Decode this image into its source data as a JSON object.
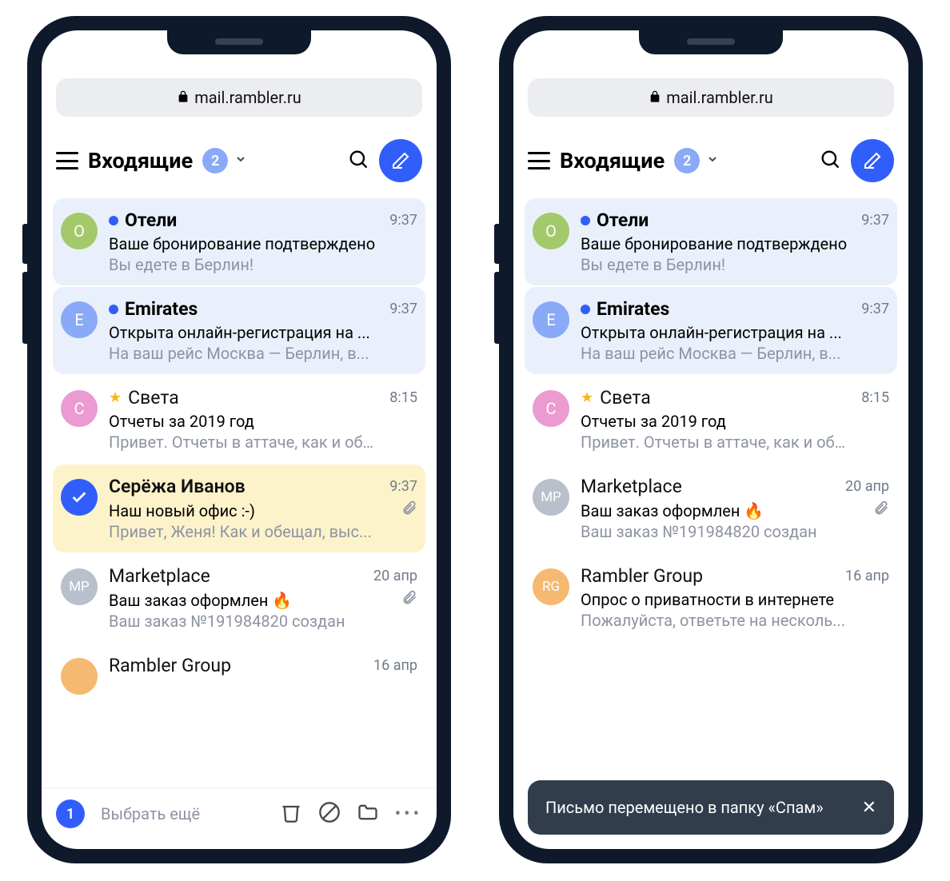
{
  "url": "mail.rambler.ru",
  "header": {
    "folder": "Входящие",
    "unread_count": "2"
  },
  "left": {
    "emails": [
      {
        "avatar_letter": "О",
        "avatar_color": "#a3c96b",
        "unread": true,
        "sender": "Отели",
        "time": "9:37",
        "subject": "Ваше бронирование подтверждено",
        "preview": "Вы едете в Берлин!"
      },
      {
        "avatar_letter": "E",
        "avatar_color": "#8aaaf8",
        "unread": true,
        "sender": "Emirates",
        "time": "9:37",
        "subject": "Открыта онлайн-регистрация на ...",
        "preview": "На ваш рейс Москва — Берлин, в..."
      },
      {
        "avatar_letter": "С",
        "avatar_color": "#eb9bd1",
        "starred": true,
        "sender": "Света",
        "time": "8:15",
        "subject": "Отчеты за 2019 год",
        "preview": "Привет. Отчеты в аттаче, как и об…"
      },
      {
        "selected": true,
        "sender": "Серёжа Иванов",
        "time": "9:37",
        "subject": "Наш новый офис :-)",
        "preview": "Привет, Женя! Как и обещал, выс...",
        "attachment": true
      },
      {
        "avatar_letter": "MP",
        "avatar_color": "#b8c0cc",
        "sender": "Marketplace",
        "time": "20 апр",
        "subject": "Ваш заказ оформлен 🔥",
        "preview": "Ваш заказ №191984820 создан",
        "attachment": true
      },
      {
        "avatar_letter": "",
        "avatar_color": "#f5b971",
        "sender": "Rambler Group",
        "time": "16 апр",
        "subject": "",
        "preview": ""
      }
    ],
    "bottom": {
      "selected_count": "1",
      "select_more": "Выбрать ещё"
    }
  },
  "right": {
    "emails": [
      {
        "avatar_letter": "О",
        "avatar_color": "#a3c96b",
        "unread": true,
        "sender": "Отели",
        "time": "9:37",
        "subject": "Ваше бронирование подтверждено",
        "preview": "Вы едете в Берлин!"
      },
      {
        "avatar_letter": "E",
        "avatar_color": "#8aaaf8",
        "unread": true,
        "sender": "Emirates",
        "time": "9:37",
        "subject": "Открыта онлайн-регистрация на ...",
        "preview": "На ваш рейс Москва — Берлин, в..."
      },
      {
        "avatar_letter": "С",
        "avatar_color": "#eb9bd1",
        "starred": true,
        "sender": "Света",
        "time": "8:15",
        "subject": "Отчеты за 2019 год",
        "preview": "Привет. Отчеты в аттаче, как и об…"
      },
      {
        "avatar_letter": "MP",
        "avatar_color": "#b8c0cc",
        "sender": "Marketplace",
        "time": "20 апр",
        "subject": "Ваш заказ оформлен 🔥",
        "preview": "Ваш заказ №191984820 создан",
        "attachment": true
      },
      {
        "avatar_letter": "RG",
        "avatar_color": "#f5b971",
        "sender": "Rambler Group",
        "time": "16 апр",
        "subject": "Опрос о приватности в интернете",
        "preview": "Пожалуйста, ответьте на несколь..."
      }
    ],
    "toast": "Письмо перемещено в папку «Спам»"
  }
}
